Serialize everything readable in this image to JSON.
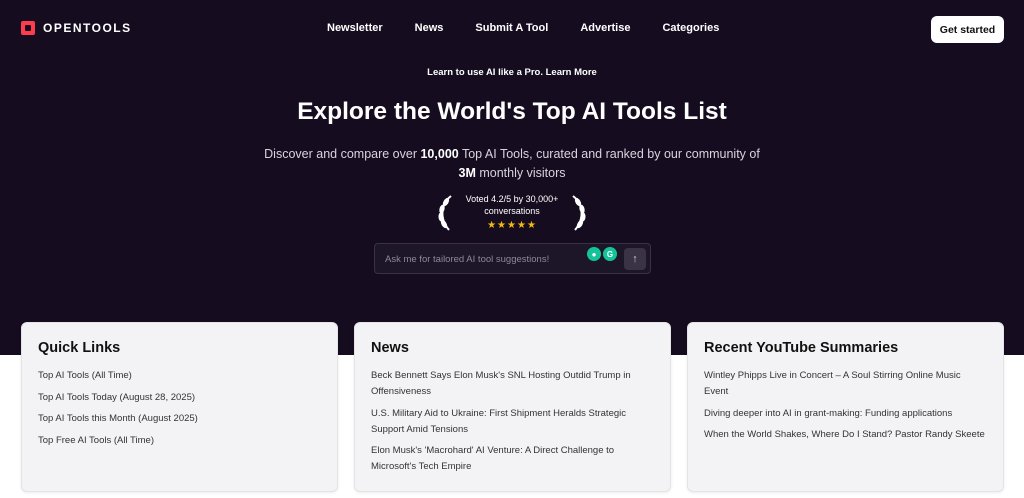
{
  "brand": {
    "name": "OPENTOOLS",
    "accent_color": "#ff3b4e",
    "bg_color": "#150d1f"
  },
  "nav": {
    "items": [
      "Newsletter",
      "News",
      "Submit A Tool",
      "Advertise",
      "Categories"
    ]
  },
  "cta": {
    "label": "Get started"
  },
  "hero": {
    "promo": "Learn to use AI like a Pro. Learn More",
    "title": "Explore the World's Top AI Tools List",
    "subtitle_1": "Discover and compare over ",
    "subtitle_bold_1": "10,000",
    "subtitle_2": " Top AI Tools, curated and ranked by our community of ",
    "subtitle_bold_2": "3M",
    "subtitle_3": " monthly visitors",
    "badge_text": "Voted 4.2/5 by 30,000+ conversations",
    "stars": "★★★★★",
    "rating": 5
  },
  "search": {
    "placeholder": "Ask me for tailored AI tool suggestions!",
    "value": ""
  },
  "cards": [
    {
      "title": "Quick Links",
      "items": [
        "Top AI Tools (All Time)",
        "Top AI Tools Today (August 28, 2025)",
        "Top AI Tools this Month (August 2025)",
        "Top Free AI Tools (All Time)"
      ]
    },
    {
      "title": "News",
      "items": [
        "Beck Bennett Says Elon Musk's SNL Hosting Outdid Trump in Offensiveness",
        "U.S. Military Aid to Ukraine: First Shipment Heralds Strategic Support Amid Tensions",
        "Elon Musk's 'Macrohard' AI Venture: A Direct Challenge to Microsoft's Tech Empire"
      ]
    },
    {
      "title": "Recent YouTube Summaries",
      "items": [
        "Wintley Phipps Live in Concert – A Soul Stirring Online Music Event",
        "Diving deeper into AI in grant-making: Funding applications",
        "When the World Shakes, Where Do I Stand? Pastor Randy Skeete"
      ]
    }
  ]
}
